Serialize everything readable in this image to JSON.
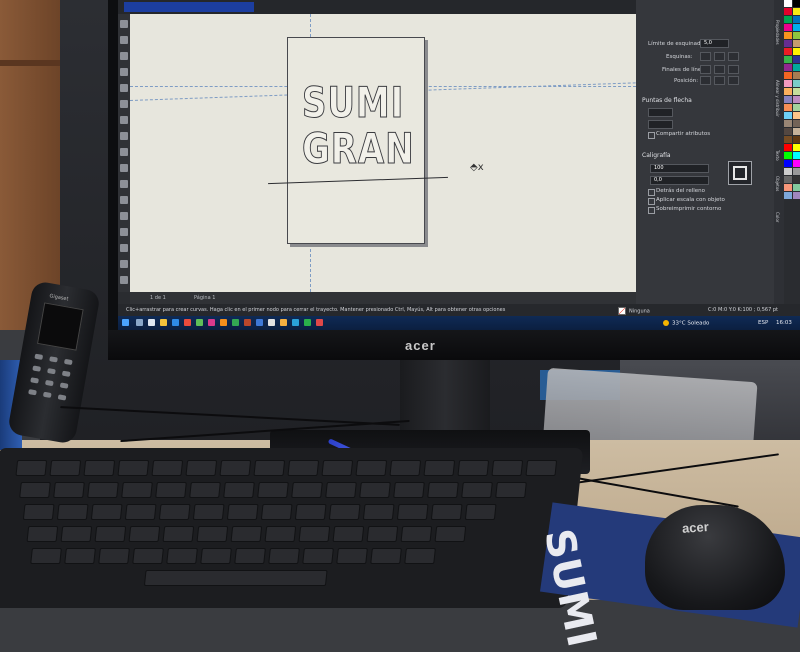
{
  "screen": {
    "artwork": {
      "line1": "SUMI",
      "line2": "GRAN"
    },
    "cursor_glyph": "⬘x",
    "page_nav": {
      "counter": "1 de 1",
      "page_tab": "Página 1"
    },
    "status_hint": "Clic+arrastrar para crear curvas. Haga clic en el primer nodo para cerrar el trayecto. Mantener presionado Ctrl, Mayús, Alt para obtener otras opciones",
    "fill_status": "Ninguna",
    "coords": "C:0 M:0 Y:0 K:100 ; 0,567 pt",
    "docker": {
      "corner_radius_label": "Límite de esquinado:",
      "corner_radius_value": "5,0",
      "corners_label": "Esquinas:",
      "line_caps_label": "Finales de línea:",
      "position_label": "Posición:",
      "arrowheads_title": "Puntas de flecha",
      "share_attrs_label": "Compartir atributos",
      "calligraphy_title": "Caligrafía",
      "stretch_value": "100",
      "angle_value": "0,0",
      "behind_fill_label": "Detrás del relleno",
      "scale_with_object_label": "Aplicar escala con objeto",
      "overprint_label": "Sobreimprimir contorno"
    },
    "side_tabs": [
      "Propiedades",
      "Alinear y distribuir",
      "Texto",
      "Objetos",
      "Color"
    ],
    "palette_colors": [
      "#ffffff",
      "#000000",
      "#e4002b",
      "#f6eb14",
      "#00a651",
      "#0072bc",
      "#ec008c",
      "#00aeef",
      "#f7941d",
      "#8dc63f",
      "#662d91",
      "#c69c6d",
      "#ed1c24",
      "#fff200",
      "#39b54a",
      "#2e3192",
      "#92278f",
      "#00a99d",
      "#f26522",
      "#a67c52",
      "#f49ac1",
      "#7accc8",
      "#fbaf5d",
      "#c4df9b",
      "#8781bd",
      "#bd8cbf",
      "#f68e56",
      "#a3d39c",
      "#6dcff6",
      "#fdc689",
      "#998675",
      "#736357",
      "#534741",
      "#c7b299",
      "#754c24",
      "#603913",
      "#ff0000",
      "#ffff00",
      "#00ff00",
      "#00ffff",
      "#0000ff",
      "#ff00ff",
      "#ccc",
      "#999",
      "#666",
      "#333",
      "#f7977a",
      "#82ca9d",
      "#7da7d9",
      "#a187be"
    ]
  },
  "taskbar": {
    "weather": "33°C  Soleado",
    "language": "ESP",
    "time": "16:03"
  },
  "monitor": {
    "brand": "acer"
  },
  "phone": {
    "brand": "Gigaset"
  },
  "mouse": {
    "brand": "acer"
  },
  "mousepad": {
    "text": "SUMI"
  }
}
